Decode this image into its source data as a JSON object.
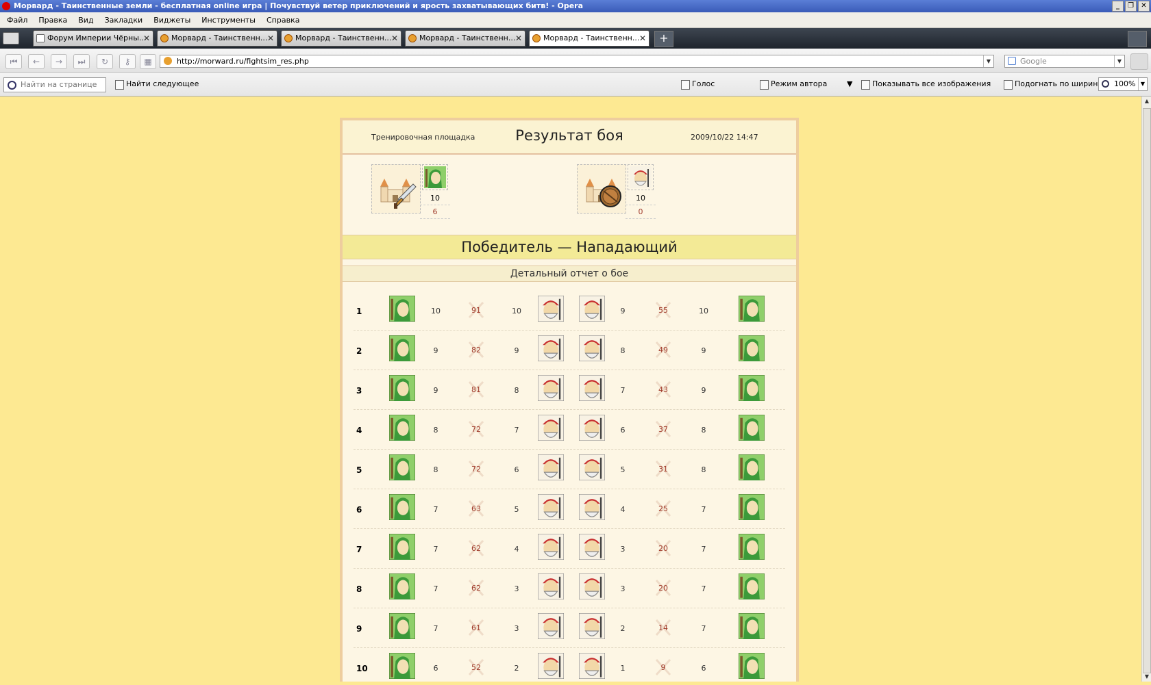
{
  "window": {
    "title": "Морвард - Таинственные земли - бесплатная online игра | Почувствуй ветер приключений и ярость захватывающих битв! - Opera"
  },
  "menu": [
    "Файл",
    "Правка",
    "Вид",
    "Закладки",
    "Виджеты",
    "Инструменты",
    "Справка"
  ],
  "tabs": [
    {
      "label": "Форум Империи Чёрны..."
    },
    {
      "label": "Морвард - Таинственн..."
    },
    {
      "label": "Морвард - Таинственн..."
    },
    {
      "label": "Морвард - Таинственн..."
    },
    {
      "label": "Морвард - Таинственн..."
    }
  ],
  "address": {
    "url": "http://morward.ru/fightsim_res.php",
    "search_placeholder": "Google"
  },
  "findbar": {
    "find_placeholder": "Найти на странице",
    "find_next": "Найти следующее",
    "voice": "Голос",
    "author_mode": "Режим автора",
    "show_images": "Показывать все изображения",
    "fit_width": "Подогнать по ширине",
    "zoom": "100%"
  },
  "battle": {
    "location": "Тренировочная площадка",
    "title": "Результат боя",
    "date": "2009/10/22 14:47",
    "attacker": {
      "count": "10",
      "remaining": "6"
    },
    "defender": {
      "count": "10",
      "remaining": "0"
    },
    "winner": "Победитель — Нападающий",
    "detail_title": "Детальный отчет о бое",
    "rounds": [
      {
        "n": "1",
        "a1": "10",
        "d1": "91",
        "b1": "10",
        "b2": "9",
        "d2": "55",
        "a2": "10"
      },
      {
        "n": "2",
        "a1": "9",
        "d1": "82",
        "b1": "9",
        "b2": "8",
        "d2": "49",
        "a2": "9"
      },
      {
        "n": "3",
        "a1": "9",
        "d1": "81",
        "b1": "8",
        "b2": "7",
        "d2": "43",
        "a2": "9"
      },
      {
        "n": "4",
        "a1": "8",
        "d1": "72",
        "b1": "7",
        "b2": "6",
        "d2": "37",
        "a2": "8"
      },
      {
        "n": "5",
        "a1": "8",
        "d1": "72",
        "b1": "6",
        "b2": "5",
        "d2": "31",
        "a2": "8"
      },
      {
        "n": "6",
        "a1": "7",
        "d1": "63",
        "b1": "5",
        "b2": "4",
        "d2": "25",
        "a2": "7"
      },
      {
        "n": "7",
        "a1": "7",
        "d1": "62",
        "b1": "4",
        "b2": "3",
        "d2": "20",
        "a2": "7"
      },
      {
        "n": "8",
        "a1": "7",
        "d1": "62",
        "b1": "3",
        "b2": "3",
        "d2": "20",
        "a2": "7"
      },
      {
        "n": "9",
        "a1": "7",
        "d1": "61",
        "b1": "3",
        "b2": "2",
        "d2": "14",
        "a2": "7"
      },
      {
        "n": "10",
        "a1": "6",
        "d1": "52",
        "b1": "2",
        "b2": "1",
        "d2": "9",
        "a2": "6"
      }
    ]
  }
}
